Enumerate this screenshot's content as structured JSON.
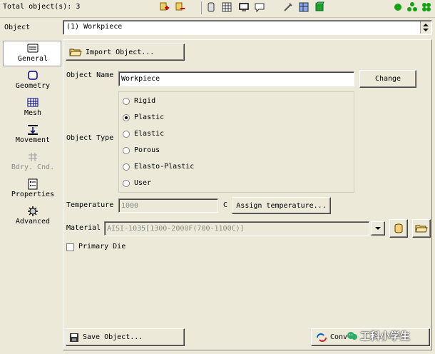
{
  "toolbar": {
    "total_objects": "Total object(s): 3"
  },
  "object_selector": {
    "label": "Object",
    "value": "(1) Workpiece"
  },
  "nav": {
    "items": [
      {
        "label": "General"
      },
      {
        "label": "Geometry"
      },
      {
        "label": "Mesh"
      },
      {
        "label": "Movement"
      },
      {
        "label": "Bdry. Cnd."
      },
      {
        "label": "Properties"
      },
      {
        "label": "Advanced"
      }
    ]
  },
  "general": {
    "import_label": "Import Object...",
    "object_name_label": "Object Name",
    "object_name_value": "Workpiece",
    "change_label": "Change",
    "object_type_label": "Object Type",
    "types": [
      {
        "label": "Rigid",
        "selected": false
      },
      {
        "label": "Plastic",
        "selected": true
      },
      {
        "label": "Elastic",
        "selected": false
      },
      {
        "label": "Porous",
        "selected": false
      },
      {
        "label": "Elasto-Plastic",
        "selected": false
      },
      {
        "label": "User",
        "selected": false
      }
    ],
    "temperature_label": "Temperature",
    "temperature_value": "1000",
    "temperature_unit": "C",
    "assign_temp_label": "Assign temperature...",
    "material_label": "Material",
    "material_value": "AISI-1035[1300-2000F(700-1100C)]",
    "primary_die_label": "Primary Die",
    "save_label": "Save Object...",
    "convert_label": "Conv",
    "watermark": "工科小学生"
  },
  "colors": {
    "window_bg": "#ece9d8",
    "selected_nav_bg": "#ffffff",
    "accent_green": "#12a312"
  }
}
